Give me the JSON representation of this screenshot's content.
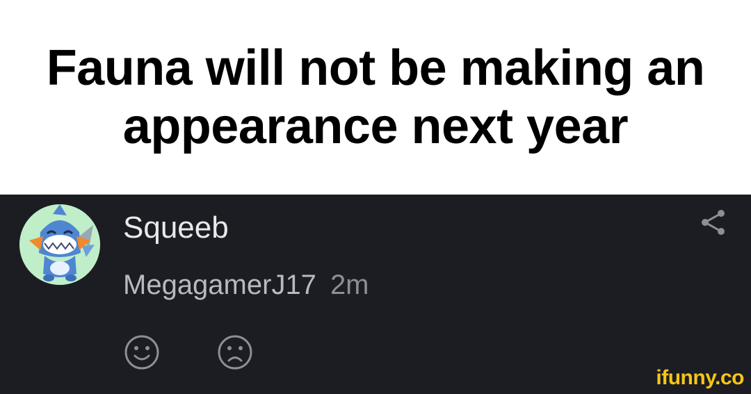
{
  "caption": {
    "text": "Fauna will not be making an appearance next year"
  },
  "comment": {
    "username": "Squeeb",
    "reply_to": "MegagamerJ17",
    "time": "2m",
    "avatar_icon": "shark-pokemon-avatar",
    "share_icon": "share-icon",
    "reactions": [
      "smile-icon",
      "frown-icon"
    ]
  },
  "watermark": {
    "text": "ifunny.co"
  },
  "colors": {
    "caption_bg": "#ffffff",
    "panel_bg": "#1c1d22",
    "username": "#e9e9ec",
    "meta": "#b9b9bf",
    "icon": "#8e8e95",
    "watermark": "#f5c518",
    "avatar_bg": "#bfeec9"
  }
}
